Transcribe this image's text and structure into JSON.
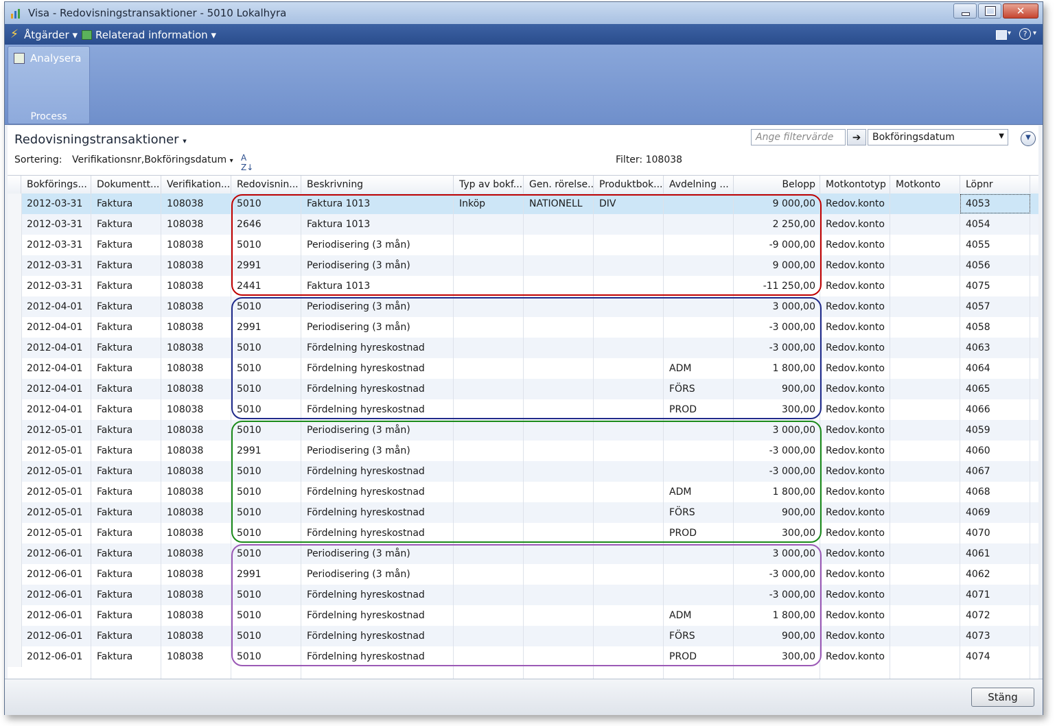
{
  "window": {
    "title": "Visa - Redovisningstransaktioner - 5010 Lokalhyra"
  },
  "menu": {
    "actions": "Åtgärder",
    "related": "Relaterad information"
  },
  "ribbon": {
    "analyze": "Analysera",
    "group": "Process"
  },
  "list": {
    "title": "Redovisningstransaktioner",
    "sort_label": "Sortering:",
    "sort_value": "Verifikationsnr,Bokföringsdatum",
    "filter_label": "Filter: 108038",
    "filter_placeholder": "Ange filtervärde",
    "filter_field": "Bokföringsdatum"
  },
  "columns": [
    "Bokförings...",
    "Dokumentt...",
    "Verifikation...",
    "Redovisnin...",
    "Beskrivning",
    "Typ av bokf...",
    "Gen. rörelse...",
    "Produktbok...",
    "Avdelning ...",
    "Belopp",
    "Motkontotyp",
    "Motkonto",
    "Löpnr"
  ],
  "rows": [
    [
      "2012-03-31",
      "Faktura",
      "108038",
      "5010",
      "Faktura 1013",
      "Inköp",
      "NATIONELL",
      "DIV",
      "",
      "9 000,00",
      "Redov.konto",
      "",
      "4053"
    ],
    [
      "2012-03-31",
      "Faktura",
      "108038",
      "2646",
      "Faktura 1013",
      "",
      "",
      "",
      "",
      "2 250,00",
      "Redov.konto",
      "",
      "4054"
    ],
    [
      "2012-03-31",
      "Faktura",
      "108038",
      "5010",
      "Periodisering (3 mån)",
      "",
      "",
      "",
      "",
      "-9 000,00",
      "Redov.konto",
      "",
      "4055"
    ],
    [
      "2012-03-31",
      "Faktura",
      "108038",
      "2991",
      "Periodisering (3 mån)",
      "",
      "",
      "",
      "",
      "9 000,00",
      "Redov.konto",
      "",
      "4056"
    ],
    [
      "2012-03-31",
      "Faktura",
      "108038",
      "2441",
      "Faktura 1013",
      "",
      "",
      "",
      "",
      "-11 250,00",
      "Redov.konto",
      "",
      "4075"
    ],
    [
      "2012-04-01",
      "Faktura",
      "108038",
      "5010",
      "Periodisering (3 mån)",
      "",
      "",
      "",
      "",
      "3 000,00",
      "Redov.konto",
      "",
      "4057"
    ],
    [
      "2012-04-01",
      "Faktura",
      "108038",
      "2991",
      "Periodisering (3 mån)",
      "",
      "",
      "",
      "",
      "-3 000,00",
      "Redov.konto",
      "",
      "4058"
    ],
    [
      "2012-04-01",
      "Faktura",
      "108038",
      "5010",
      "Fördelning hyreskostnad",
      "",
      "",
      "",
      "",
      "-3 000,00",
      "Redov.konto",
      "",
      "4063"
    ],
    [
      "2012-04-01",
      "Faktura",
      "108038",
      "5010",
      "Fördelning hyreskostnad",
      "",
      "",
      "",
      "ADM",
      "1 800,00",
      "Redov.konto",
      "",
      "4064"
    ],
    [
      "2012-04-01",
      "Faktura",
      "108038",
      "5010",
      "Fördelning hyreskostnad",
      "",
      "",
      "",
      "FÖRS",
      "900,00",
      "Redov.konto",
      "",
      "4065"
    ],
    [
      "2012-04-01",
      "Faktura",
      "108038",
      "5010",
      "Fördelning hyreskostnad",
      "",
      "",
      "",
      "PROD",
      "300,00",
      "Redov.konto",
      "",
      "4066"
    ],
    [
      "2012-05-01",
      "Faktura",
      "108038",
      "5010",
      "Periodisering (3 mån)",
      "",
      "",
      "",
      "",
      "3 000,00",
      "Redov.konto",
      "",
      "4059"
    ],
    [
      "2012-05-01",
      "Faktura",
      "108038",
      "2991",
      "Periodisering (3 mån)",
      "",
      "",
      "",
      "",
      "-3 000,00",
      "Redov.konto",
      "",
      "4060"
    ],
    [
      "2012-05-01",
      "Faktura",
      "108038",
      "5010",
      "Fördelning hyreskostnad",
      "",
      "",
      "",
      "",
      "-3 000,00",
      "Redov.konto",
      "",
      "4067"
    ],
    [
      "2012-05-01",
      "Faktura",
      "108038",
      "5010",
      "Fördelning hyreskostnad",
      "",
      "",
      "",
      "ADM",
      "1 800,00",
      "Redov.konto",
      "",
      "4068"
    ],
    [
      "2012-05-01",
      "Faktura",
      "108038",
      "5010",
      "Fördelning hyreskostnad",
      "",
      "",
      "",
      "FÖRS",
      "900,00",
      "Redov.konto",
      "",
      "4069"
    ],
    [
      "2012-05-01",
      "Faktura",
      "108038",
      "5010",
      "Fördelning hyreskostnad",
      "",
      "",
      "",
      "PROD",
      "300,00",
      "Redov.konto",
      "",
      "4070"
    ],
    [
      "2012-06-01",
      "Faktura",
      "108038",
      "5010",
      "Periodisering (3 mån)",
      "",
      "",
      "",
      "",
      "3 000,00",
      "Redov.konto",
      "",
      "4061"
    ],
    [
      "2012-06-01",
      "Faktura",
      "108038",
      "2991",
      "Periodisering (3 mån)",
      "",
      "",
      "",
      "",
      "-3 000,00",
      "Redov.konto",
      "",
      "4062"
    ],
    [
      "2012-06-01",
      "Faktura",
      "108038",
      "5010",
      "Fördelning hyreskostnad",
      "",
      "",
      "",
      "",
      "-3 000,00",
      "Redov.konto",
      "",
      "4071"
    ],
    [
      "2012-06-01",
      "Faktura",
      "108038",
      "5010",
      "Fördelning hyreskostnad",
      "",
      "",
      "",
      "ADM",
      "1 800,00",
      "Redov.konto",
      "",
      "4072"
    ],
    [
      "2012-06-01",
      "Faktura",
      "108038",
      "5010",
      "Fördelning hyreskostnad",
      "",
      "",
      "",
      "FÖRS",
      "900,00",
      "Redov.konto",
      "",
      "4073"
    ],
    [
      "2012-06-01",
      "Faktura",
      "108038",
      "5010",
      "Fördelning hyreskostnad",
      "",
      "",
      "",
      "PROD",
      "300,00",
      "Redov.konto",
      "",
      "4074"
    ]
  ],
  "highlight_groups": [
    {
      "rows_from": 0,
      "rows_to": 4,
      "color": "#c00000"
    },
    {
      "rows_from": 5,
      "rows_to": 10,
      "color": "#1f2a8a"
    },
    {
      "rows_from": 11,
      "rows_to": 16,
      "color": "#1a8a1a"
    },
    {
      "rows_from": 17,
      "rows_to": 22,
      "color": "#9b59b6"
    }
  ],
  "footer": {
    "close": "Stäng"
  }
}
